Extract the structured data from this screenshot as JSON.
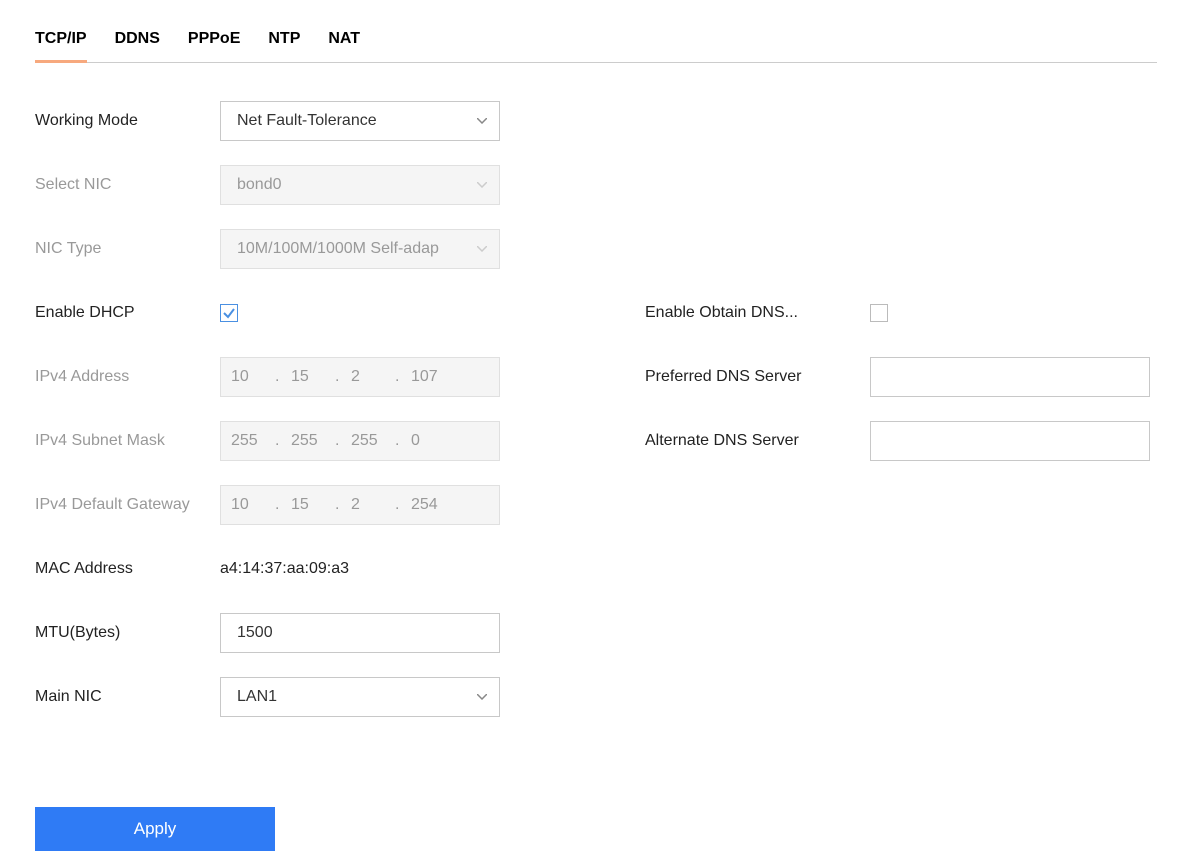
{
  "tabs": [
    "TCP/IP",
    "DDNS",
    "PPPoE",
    "NTP",
    "NAT"
  ],
  "active_tab": "TCP/IP",
  "labels": {
    "working_mode": "Working Mode",
    "select_nic": "Select NIC",
    "nic_type": "NIC Type",
    "enable_dhcp": "Enable DHCP",
    "ipv4_address": "IPv4 Address",
    "ipv4_subnet": "IPv4 Subnet Mask",
    "ipv4_gateway": "IPv4 Default Gateway",
    "mac_address": "MAC Address",
    "mtu": "MTU(Bytes)",
    "main_nic": "Main NIC",
    "enable_obtain_dns": "Enable Obtain DNS...",
    "preferred_dns": "Preferred DNS Server",
    "alternate_dns": "Alternate DNS Server"
  },
  "values": {
    "working_mode": "Net Fault-Tolerance",
    "select_nic": "bond0",
    "nic_type": "10M/100M/1000M Self-adap",
    "enable_dhcp_checked": true,
    "ipv4_address": [
      "10",
      "15",
      "2",
      "107"
    ],
    "ipv4_subnet": [
      "255",
      "255",
      "255",
      "0"
    ],
    "ipv4_gateway": [
      "10",
      "15",
      "2",
      "254"
    ],
    "mac_address": "a4:14:37:aa:09:a3",
    "mtu": "1500",
    "main_nic": "LAN1",
    "enable_obtain_dns_checked": false,
    "preferred_dns": "",
    "alternate_dns": ""
  },
  "buttons": {
    "apply": "Apply"
  }
}
